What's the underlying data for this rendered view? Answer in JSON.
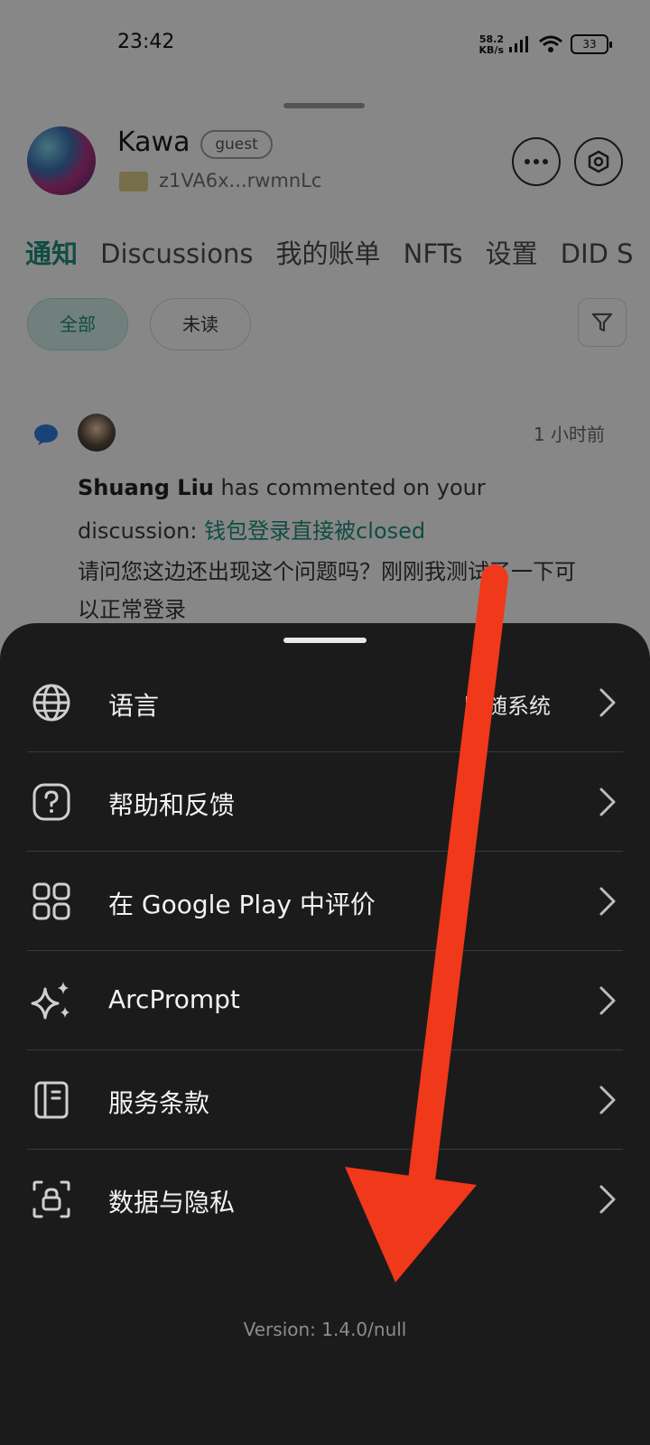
{
  "status_bar": {
    "time": "23:42",
    "net_speed": "58.2\nKB/s",
    "battery": "33"
  },
  "profile": {
    "name": "Kawa",
    "badge": "guest",
    "wallet_address": "z1VA6x...rwmnLc"
  },
  "tabs": [
    "通知",
    "Discussions",
    "我的账单",
    "NFTs",
    "设置",
    "DID S"
  ],
  "filters": {
    "all": "全部",
    "unread": "未读"
  },
  "notification": {
    "time": "1 小时前",
    "author": "Shuang Liu",
    "action": " has commented on your",
    "prefix": "discussion: ",
    "link": "钱包登录直接被closed",
    "body": "请问您这边还出现这个问题吗？刚刚我测试了一下可以正常登录"
  },
  "sheet": {
    "items": [
      {
        "label": "语言",
        "value": "跟随系统",
        "icon": "globe-icon"
      },
      {
        "label": "帮助和反馈",
        "value": "",
        "icon": "help-icon"
      },
      {
        "label": "在 Google Play 中评价",
        "value": "",
        "icon": "apps-grid-icon"
      },
      {
        "label": "ArcPrompt",
        "value": "",
        "icon": "sparkle-icon"
      },
      {
        "label": "服务条款",
        "value": "",
        "icon": "book-icon"
      },
      {
        "label": "数据与隐私",
        "value": "",
        "icon": "lock-icon"
      }
    ],
    "version": "Version: 1.4.0/null"
  },
  "colors": {
    "accent": "#1e8a78",
    "sheet_bg": "#1b1b1b",
    "annotation_arrow": "#f0381a"
  }
}
